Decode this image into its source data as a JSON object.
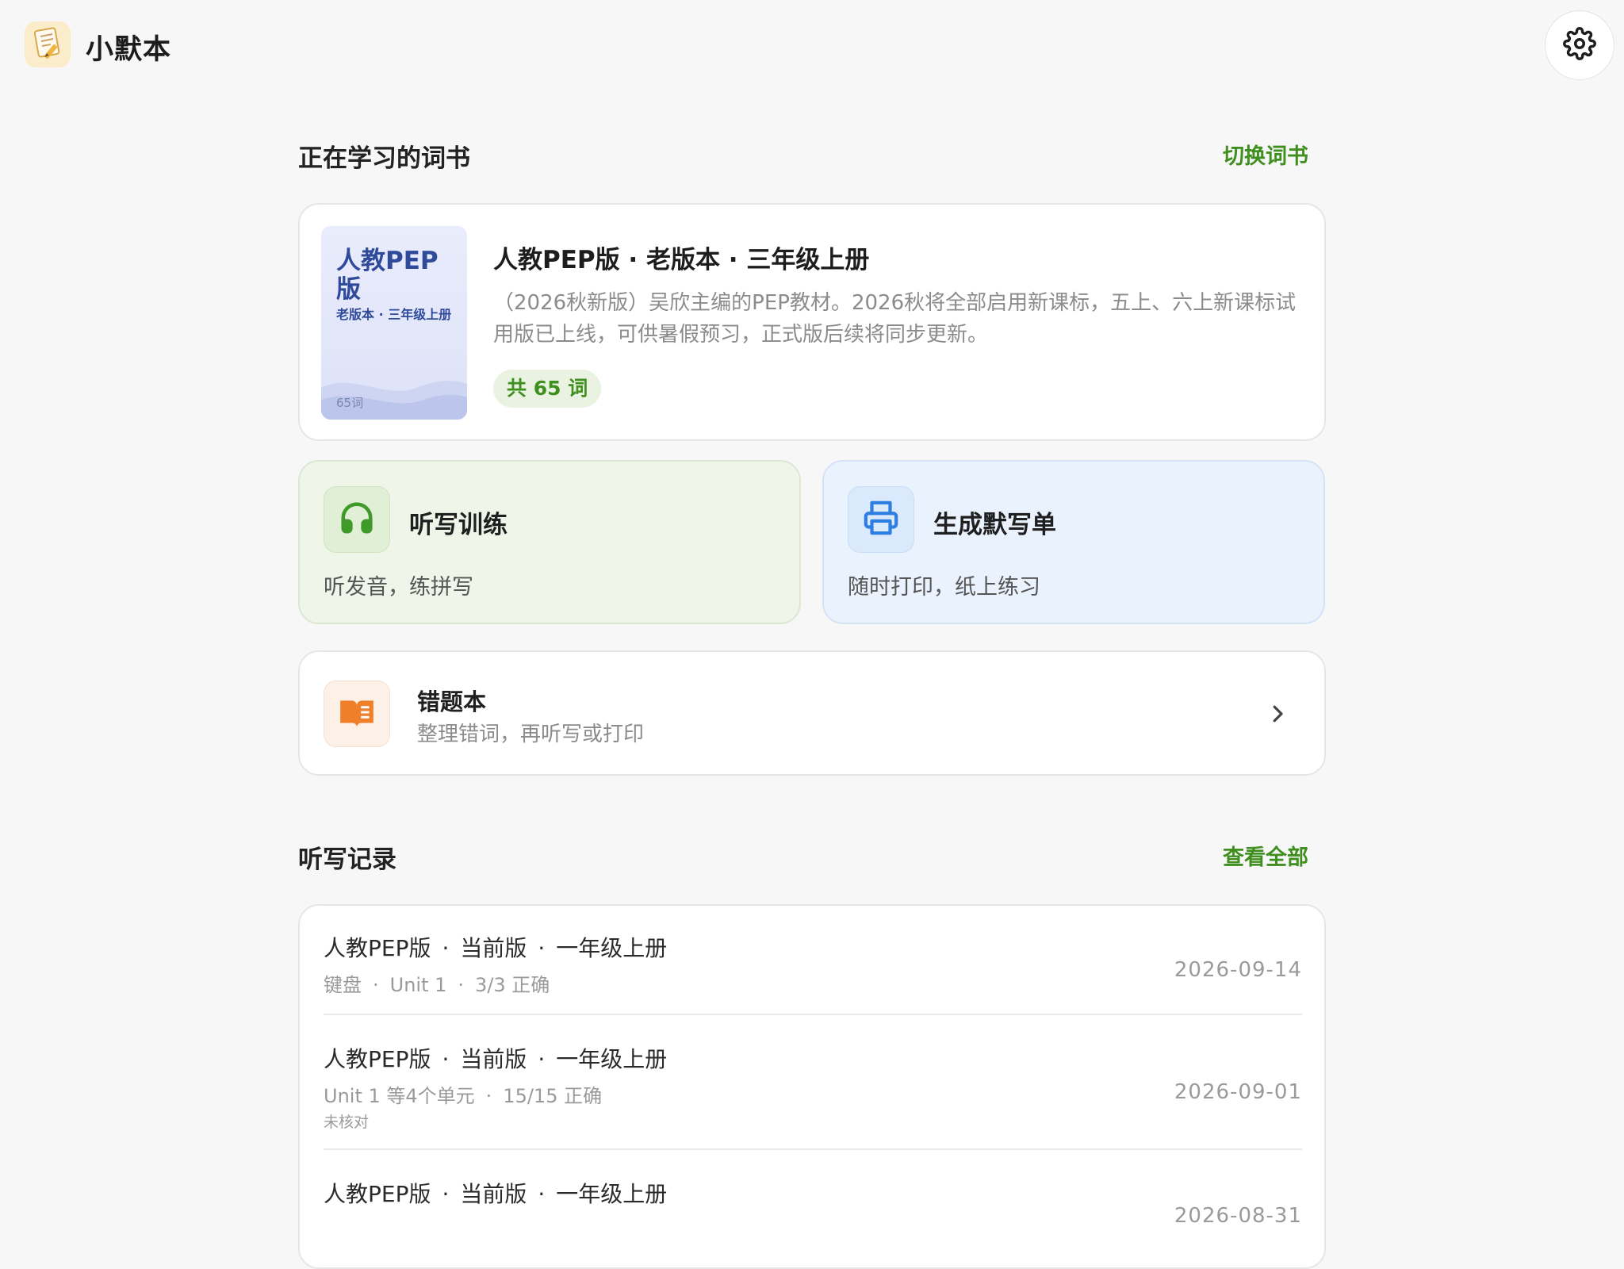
{
  "app": {
    "title": "小默本"
  },
  "current_book": {
    "section_title": "正在学习的词书",
    "switch_label": "切换词书",
    "cover": {
      "title": "人教PEP版",
      "subtitle": "老版本 · 三年级上册",
      "count": "65词"
    },
    "title": "人教PEP版 · 老版本 · 三年级上册",
    "description": "（2026秋新版）吴欣主编的PEP教材。2026秋将全部启用新课标，五上、六上新课标试用版已上线，可供暑假预习，正式版后续将同步更新。",
    "word_count": "共 65 词"
  },
  "actions": {
    "dictation": {
      "title": "听写训练",
      "subtitle": "听发音，练拼写"
    },
    "print": {
      "title": "生成默写单",
      "subtitle": "随时打印，纸上练习"
    }
  },
  "mistakes": {
    "title": "错题本",
    "subtitle": "整理错词，再听写或打印"
  },
  "history": {
    "section_title": "听写记录",
    "view_all_label": "查看全部",
    "records": [
      {
        "book": "人教PEP版",
        "version": "当前版",
        "grade": "一年级上册",
        "mode": "键盘",
        "scope": "Unit 1",
        "score": "3/3 正确",
        "note": "",
        "date": "2026-09-14"
      },
      {
        "book": "人教PEP版",
        "version": "当前版",
        "grade": "一年级上册",
        "mode": "",
        "scope": "Unit 1 等4个单元",
        "score": "15/15 正确",
        "note": "未核对",
        "date": "2026-09-01"
      },
      {
        "book": "人教PEP版",
        "version": "当前版",
        "grade": "一年级上册",
        "mode": "",
        "scope": "",
        "score": "",
        "note": "",
        "date": "2026-08-31"
      }
    ]
  },
  "colors": {
    "accent_green": "#3f8f1f",
    "print_blue": "#2f7fe0",
    "mistake_orange": "#f07f2a"
  },
  "icons": {
    "logo": "notebook-pencil-icon",
    "settings": "gear-icon",
    "dictation": "headphones-icon",
    "print": "printer-icon",
    "mistakes": "open-book-icon",
    "chevron": "chevron-right-icon"
  }
}
